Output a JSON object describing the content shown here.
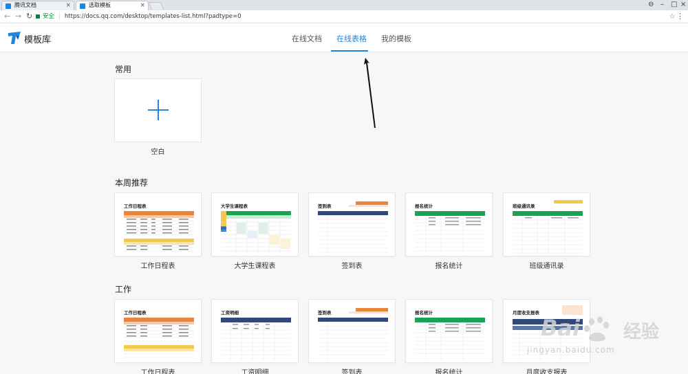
{
  "browser": {
    "tabs": [
      {
        "label": "腾讯文档"
      },
      {
        "label": "选取模板"
      }
    ],
    "url": "https://docs.qq.com/desktop/templates-list.html?padtype=0",
    "secure_label": "安全"
  },
  "header": {
    "logo_text": "模板库",
    "nav": [
      {
        "label": "在线文档"
      },
      {
        "label": "在线表格"
      },
      {
        "label": "我的模板"
      }
    ]
  },
  "sections": {
    "common": {
      "title": "常用",
      "blank_label": "空白"
    },
    "weekly": {
      "title": "本周推荐",
      "cards": [
        {
          "label": "工作日程表",
          "thumb_title": "工作日程表"
        },
        {
          "label": "大学生课程表",
          "thumb_title": "大学生课程表"
        },
        {
          "label": "签到表",
          "thumb_title": "签到表"
        },
        {
          "label": "报名统计",
          "thumb_title": "报名统计"
        },
        {
          "label": "班级通讯录",
          "thumb_title": "班级通讯录"
        }
      ]
    },
    "work": {
      "title": "工作",
      "cards": [
        {
          "label": "工作日程表",
          "thumb_title": "工作日程表"
        },
        {
          "label": "工资明细",
          "thumb_title": "工资明细"
        },
        {
          "label": "签到表",
          "thumb_title": "签到表"
        },
        {
          "label": "报名统计",
          "thumb_title": "报名统计"
        },
        {
          "label": "月度收支报表",
          "thumb_title": "月度收支报表"
        }
      ]
    }
  },
  "watermark": {
    "brand": "Bai",
    "brand_cn": "经验",
    "url": "jingyan.baidu.com"
  },
  "colors": {
    "accent": "#1f86de",
    "orange": "#e9843a",
    "navy": "#2f4a7a",
    "green": "#1aa356",
    "yellow": "#f2c94c"
  }
}
